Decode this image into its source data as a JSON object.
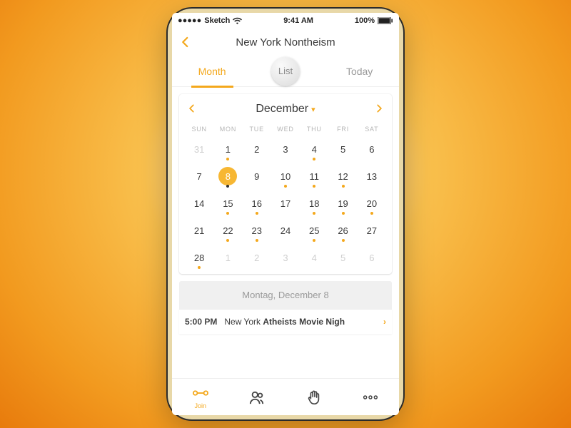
{
  "statusbar": {
    "carrier": "Sketch",
    "time": "9:41 AM",
    "battery": "100%"
  },
  "header": {
    "title": "New York Nontheism"
  },
  "tabs": {
    "month": "Month",
    "list": "List",
    "today": "Today",
    "active": "month"
  },
  "calendar": {
    "month_label": "December",
    "dow": [
      "SUN",
      "MON",
      "TUE",
      "WED",
      "THU",
      "FRI",
      "SAT"
    ],
    "cells": [
      {
        "d": 31,
        "out": true
      },
      {
        "d": 1,
        "dot": true
      },
      {
        "d": 2
      },
      {
        "d": 3
      },
      {
        "d": 4,
        "dot": true
      },
      {
        "d": 5
      },
      {
        "d": 6
      },
      {
        "d": 7
      },
      {
        "d": 8,
        "sel": true,
        "dot": true
      },
      {
        "d": 9
      },
      {
        "d": 10,
        "dot": true
      },
      {
        "d": 11,
        "dot": true
      },
      {
        "d": 12,
        "dot": true
      },
      {
        "d": 13
      },
      {
        "d": 14
      },
      {
        "d": 15,
        "dot": true
      },
      {
        "d": 16,
        "dot": true
      },
      {
        "d": 17
      },
      {
        "d": 18,
        "dot": true
      },
      {
        "d": 19,
        "dot": true
      },
      {
        "d": 20,
        "dot": true
      },
      {
        "d": 21
      },
      {
        "d": 22,
        "dot": true
      },
      {
        "d": 23,
        "dot": true
      },
      {
        "d": 24
      },
      {
        "d": 25,
        "dot": true
      },
      {
        "d": 26,
        "dot": true
      },
      {
        "d": 27
      },
      {
        "d": 28,
        "dot": true
      },
      {
        "d": 1,
        "out": true
      },
      {
        "d": 2,
        "out": true
      },
      {
        "d": 3,
        "out": true
      },
      {
        "d": 4,
        "out": true
      },
      {
        "d": 5,
        "out": true
      },
      {
        "d": 6,
        "out": true
      }
    ]
  },
  "selected_day_label": "Montag, December 8",
  "event": {
    "time": "5:00 PM",
    "title_prefix": "New York ",
    "title_bold": "Atheists Movie Nigh"
  },
  "bottomnav": {
    "join": "Join"
  },
  "colors": {
    "accent": "#f4a81c"
  }
}
